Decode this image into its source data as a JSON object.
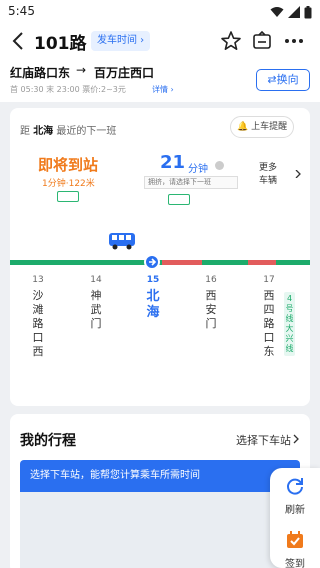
{
  "status": {
    "time": "5:45"
  },
  "header": {
    "title": "101路",
    "departure_time_label": "发车时间"
  },
  "route": {
    "from": "红庙路口东",
    "arrow": "→",
    "to": "百万庄西口",
    "meta": "首 05:30 末 23:00 票价:2~3元",
    "detail_link": "详情",
    "switch_label": "⇄换向"
  },
  "arrival": {
    "distance_prefix": "距",
    "current_stop": "北海",
    "distance_suffix": "最近的下一班",
    "remind_label": "上车提醒",
    "bus1": {
      "status": "即将到站",
      "sub": "1分钟·122米"
    },
    "bus2": {
      "minutes": "21",
      "unit": "分钟",
      "tip": "拥挤，请选择下一班"
    },
    "more_buses": [
      "更多",
      "车辆"
    ]
  },
  "stops": [
    {
      "num": "13",
      "name": "沙滩路口西"
    },
    {
      "num": "14",
      "name": "神武门"
    },
    {
      "num": "15",
      "name": "北海"
    },
    {
      "num": "16",
      "name": "西安门"
    },
    {
      "num": "17",
      "name": "西四路口东"
    }
  ],
  "subway_tag": "4号线大兴线",
  "trip": {
    "title": "我的行程",
    "select_stop": "选择下车站",
    "hint": "选择下车站，能帮您计算乘车所需时间"
  },
  "tools": {
    "refresh": "刷新",
    "checkin": "签到"
  },
  "colors": {
    "accent": "#2a6ff0",
    "arriving": "#f07a1b",
    "line_green": "#1dab6b",
    "congested": "#e25c5c"
  }
}
